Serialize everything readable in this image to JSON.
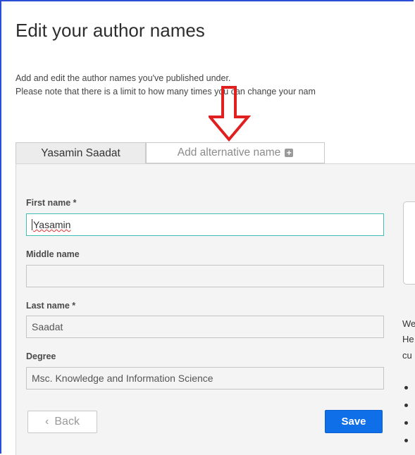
{
  "page": {
    "title": "Edit your author names",
    "intro_line1": "Add and edit the author names you've published under.",
    "intro_line2": "Please note that there is a limit to how many times you can change your nam"
  },
  "tabs": {
    "active_label": "Yasamin Saadat",
    "add_label": "Add alternative name",
    "add_icon": "plus-square-icon"
  },
  "form": {
    "first_name_label": "First name *",
    "first_name_value": "Yasamin",
    "middle_name_label": "Middle name",
    "middle_name_value": "",
    "last_name_label": "Last name *",
    "last_name_value": "Saadat",
    "degree_label": "Degree",
    "degree_value": "Msc. Knowledge and Information Science",
    "back_label": "Back",
    "save_label": "Save"
  },
  "side": {
    "line1": "We",
    "line2": "He",
    "line3": "cu"
  },
  "annotation": {
    "arrow_color": "#e02020"
  },
  "colors": {
    "accent_blue": "#0f6fe8",
    "focus_teal": "#3fbfb3",
    "frame_blue": "#2a4fd6"
  }
}
